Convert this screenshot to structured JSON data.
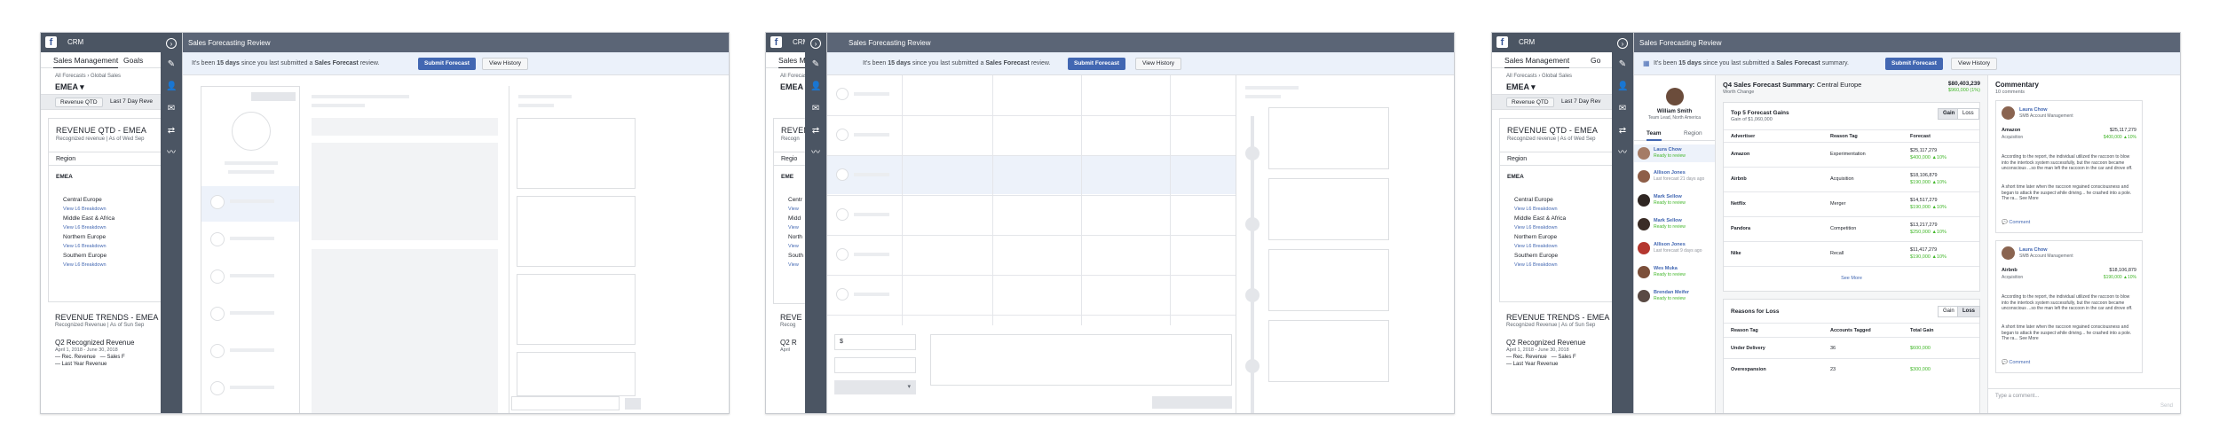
{
  "app": {
    "name": "CRM",
    "overlay_title": "Sales Forecasting Review"
  },
  "nav": {
    "tab_active": "Sales Management",
    "tab_next": "Goals",
    "tab_short": "Sales Man",
    "tab_short2": "Go"
  },
  "crumb": {
    "a": "All Forecasts",
    "b": "Global Sales"
  },
  "region": "EMEA",
  "filters": {
    "chip": "Revenue QTD",
    "next": "Last 7 Day Reve",
    "next_short": "Last 7 Day Rev"
  },
  "revenue_card": {
    "title": "REVENUE QTD - EMEA",
    "title_short": "REVEN",
    "sub": "Recognized revenue | As of Wed Sep",
    "sub_short": "Recogn",
    "col": "Region",
    "col_short": "Regio",
    "top": "EMEA",
    "top_short": "EME",
    "rows": [
      "Central Europe",
      "Middle East & Africa",
      "Northern Europe",
      "Southern Europe"
    ],
    "rows_short": [
      "Centr",
      "Midd",
      "North",
      "South"
    ],
    "link": "View L6 Breakdown",
    "link_short": "View"
  },
  "trend": {
    "title": "REVENUE TRENDS - EMEA",
    "title_short": "REVE",
    "sub": "Recognized Revenue | As of Sun Sep",
    "sub_short": "Recog",
    "q_title": "Q2 Recognized Revenue",
    "q_short": "Q2 R",
    "q_dates": "April 1, 2018 - June 30, 2018",
    "q_dates_short": "April",
    "legend": [
      "Rec. Revenue",
      "Sales F",
      "Last Year Revenue"
    ]
  },
  "banner": {
    "pre": "It's been ",
    "days": "15 days",
    "mid": " since you last submitted a ",
    "kind": "Sales Forecast",
    "end_review": " review.",
    "end_summary": " summary.",
    "submit": "Submit Forecast",
    "history": "View History"
  },
  "p2": {
    "input_value": "$"
  },
  "p3": {
    "user": {
      "name": "William Smith",
      "role": "Team Lead, North America"
    },
    "tabs": [
      "Team",
      "Region"
    ],
    "team": [
      {
        "name": "Laura Chow",
        "status": "Ready to review",
        "gray": false
      },
      {
        "name": "Allison Jones",
        "status": "Last forecast 21 days ago",
        "gray": true
      },
      {
        "name": "Mark Sellow",
        "status": "Ready to review",
        "gray": false
      },
      {
        "name": "Mark Sellow",
        "status": "Ready to review",
        "gray": false
      },
      {
        "name": "Allison Jones",
        "status": "Last forecast 9 days ago",
        "gray": true
      },
      {
        "name": "Wes Muka",
        "status": "Ready to review",
        "gray": false
      },
      {
        "name": "Brendan Meifer",
        "status": "Ready to review",
        "gray": false
      }
    ],
    "summary": {
      "title": "Q4 Sales Forecast Summary:",
      "region": "Central Europe",
      "sub": "Worth Change",
      "total": "$80,403,239",
      "delta": "$960,000 (1%)"
    },
    "gains": {
      "title": "Top 5 Forecast Gains",
      "sub": "Gain of $1,060,000",
      "toggle": [
        "Gain",
        "Loss"
      ],
      "headers": [
        "Advertiser",
        "Reason Tag",
        "Forecast"
      ],
      "rows": [
        {
          "adv": "Amazon",
          "tag": "Experimentation",
          "fc": "$25,117,279",
          "delta": "$400,000 ▲10%"
        },
        {
          "adv": "Airbnb",
          "tag": "Acquisition",
          "fc": "$18,106,879",
          "delta": "$190,000 ▲10%"
        },
        {
          "adv": "Netflix",
          "tag": "Merger",
          "fc": "$14,517,279",
          "delta": "$190,000 ▲10%"
        },
        {
          "adv": "Pandora",
          "tag": "Competition",
          "fc": "$13,217,279",
          "delta": "$250,000 ▲10%"
        },
        {
          "adv": "Nike",
          "tag": "Recall",
          "fc": "$11,417,279",
          "delta": "$190,000 ▲10%"
        }
      ],
      "more": "See More"
    },
    "loss": {
      "title": "Reasons for Loss",
      "toggle": [
        "Gain",
        "Loss"
      ],
      "headers": [
        "Reason Tag",
        "Accounts Tagged",
        "Total Gain"
      ],
      "rows": [
        {
          "tag": "Under Delivery",
          "acc": "36",
          "total": "$600,000"
        },
        {
          "tag": "Overexpansion",
          "acc": "23",
          "total": "$300,000"
        }
      ]
    },
    "commentary": {
      "title": "Commentary",
      "count": "10 comments",
      "items": [
        {
          "name": "Laura Chow",
          "role": "SMB Account Management",
          "adv": "Amazon",
          "tag": "Acquisition",
          "fc": "$25,117,279",
          "delta": "$400,000 ▲10%",
          "body": "According to the report, the individual utilized the raccoon to blow into the intertock system successfully, but the raccoon became unconscious ...so the man left the raccoon in the car and drove off.",
          "body2": "A short time later when the raccoon regained consciousness and began to attack the suspect while driving... he crashed into a pole. The ra... See More",
          "action": "Comment"
        },
        {
          "name": "Laura Chow",
          "role": "SMB Account Management",
          "adv": "Airbnb",
          "tag": "Acquisition",
          "fc": "$18,106,879",
          "delta": "$190,000 ▲10%",
          "body": "According to the report, the individual utilized the raccoon to blow into the intertock system successfully, but the raccoon became unconscious ...so the man left the raccoon in the car and drove off.",
          "body2": "A short time later when the raccoon regained consciousness and began to attack the suspect while driving... he crashed into a pole. The ra... See More",
          "action": "Comment"
        }
      ],
      "placeholder": "Type a comment...",
      "send": "Send"
    }
  }
}
